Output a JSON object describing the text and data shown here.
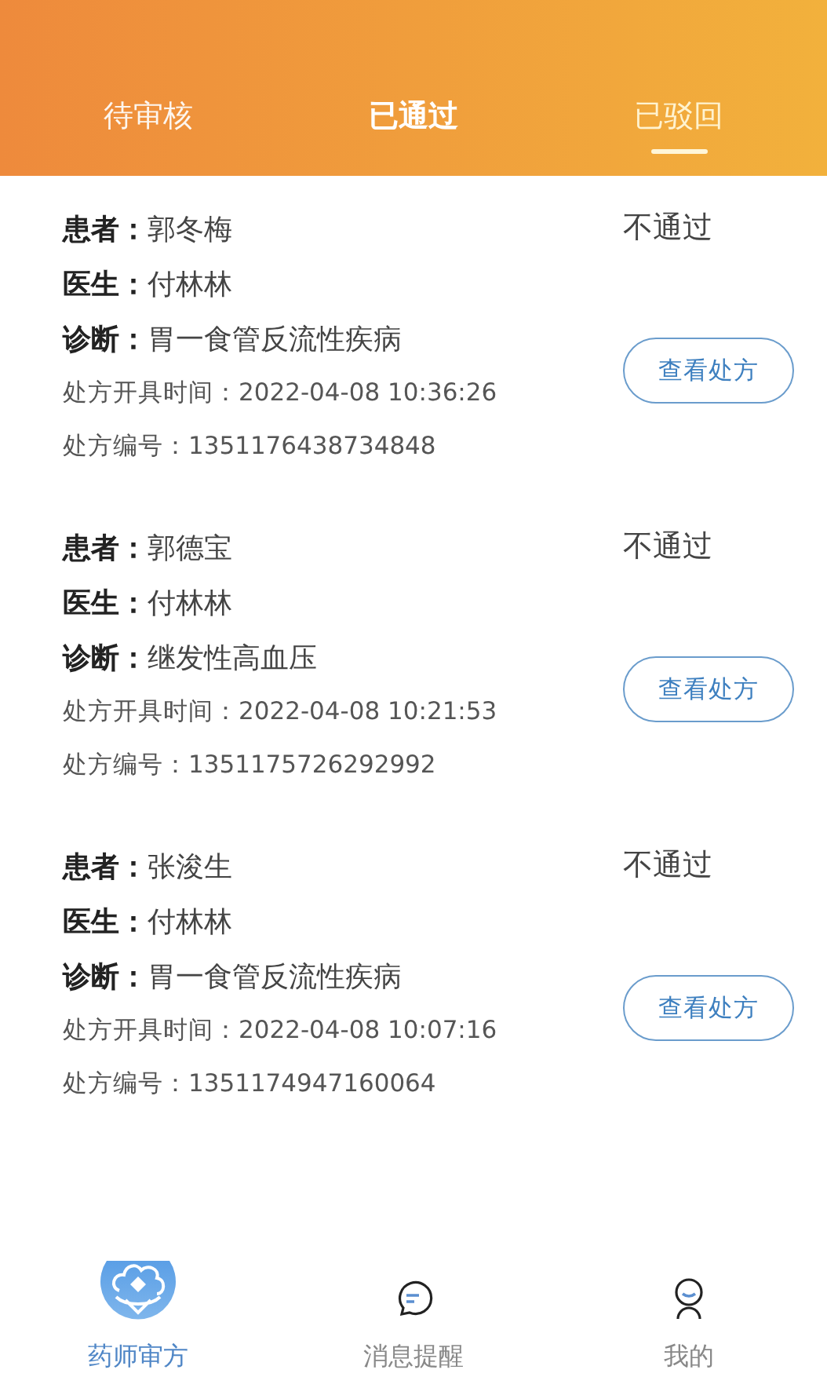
{
  "tabs": [
    {
      "label": "待审核",
      "selected": false,
      "bold": false
    },
    {
      "label": "已通过",
      "selected": false,
      "bold": true
    },
    {
      "label": "已驳回",
      "selected": true,
      "bold": false
    }
  ],
  "prescriptions": [
    {
      "patient_label": "患者：",
      "patient": "郭冬梅",
      "doctor_label": "医生：",
      "doctor": "付林林",
      "diagnosis_label": "诊断：",
      "diagnosis": "胃一食管反流性疾病",
      "time": "处方开具时间：2022-04-08 10:36:26",
      "number": "处方编号：1351176438734848",
      "status": "不通过",
      "button": "查看处方"
    },
    {
      "patient_label": "患者：",
      "patient": "郭德宝",
      "doctor_label": "医生：",
      "doctor": "付林林",
      "diagnosis_label": "诊断：",
      "diagnosis": "继发性高血压",
      "time": "处方开具时间：2022-04-08 10:21:53",
      "number": "处方编号：1351175726292992",
      "status": "不通过",
      "button": "查看处方"
    },
    {
      "patient_label": "患者：",
      "patient": "张浚生",
      "doctor_label": "医生：",
      "doctor": "付林林",
      "diagnosis_label": "诊断：",
      "diagnosis": "胃一食管反流性疾病",
      "time": "处方开具时间：2022-04-08 10:07:16",
      "number": "处方编号：1351174947160064",
      "status": "不通过",
      "button": "查看处方"
    }
  ],
  "bottom_nav": [
    {
      "label": "药师审方",
      "selected": true,
      "kind": "logo"
    },
    {
      "label": "消息提醒",
      "selected": false,
      "kind": "chat"
    },
    {
      "label": "我的",
      "selected": false,
      "kind": "person"
    }
  ]
}
